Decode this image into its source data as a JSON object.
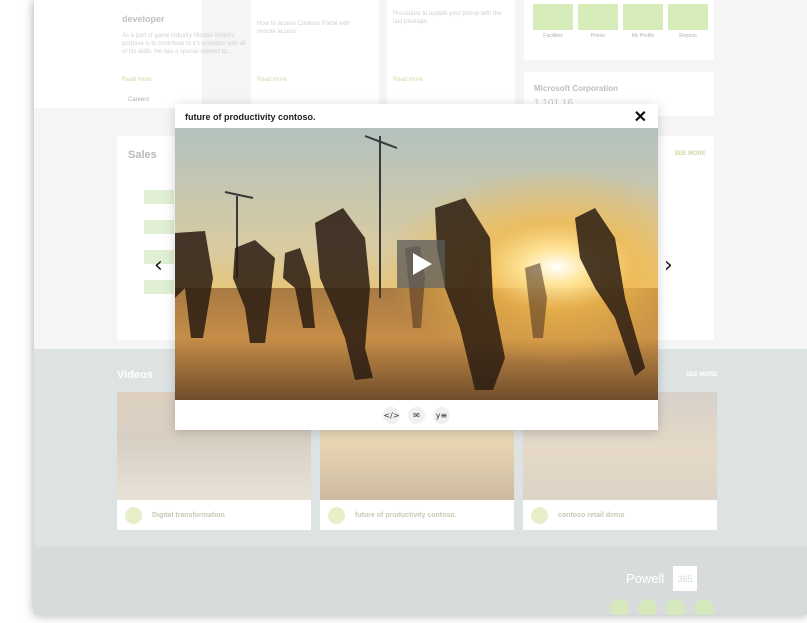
{
  "news": {
    "card1": {
      "title": "developer",
      "body": "As a part of game industry Nicolas Kollet's purpose is to contribute to it's evolution with all of his skills. He has a special interest to...",
      "link": "Read more",
      "tag": "Careers"
    },
    "card2": {
      "body": "How to access Contoso Portal with remote access",
      "link": "Read more"
    },
    "card3": {
      "body": "Procedure to update your phone with the last package.",
      "link": "Read more"
    }
  },
  "quick_links": [
    {
      "label": "Facilities"
    },
    {
      "label": "Printer"
    },
    {
      "label": "My Profile"
    },
    {
      "label": "Reports"
    }
  ],
  "stock": {
    "company": "Microsoft Corporation",
    "value": "1,101.16"
  },
  "sales": {
    "title": "Sales",
    "see_more": "SEE MORE"
  },
  "videos": {
    "title": "Videos",
    "see_more": "SEE MORE",
    "items": [
      {
        "caption": "Digital transformation"
      },
      {
        "caption": "future of productivity contoso."
      },
      {
        "caption": "contoso retail demo"
      }
    ]
  },
  "footer": {
    "brand": "Powell",
    "badge": "365"
  },
  "modal": {
    "title": "future of productivity contoso.",
    "close_glyph": "✕",
    "prev_glyph": "‹",
    "next_glyph": "›",
    "actions": [
      {
        "name": "embed-icon",
        "glyph": "</>"
      },
      {
        "name": "mail-icon",
        "glyph": "✉"
      },
      {
        "name": "yammer-icon",
        "glyph": "y≡"
      }
    ]
  }
}
